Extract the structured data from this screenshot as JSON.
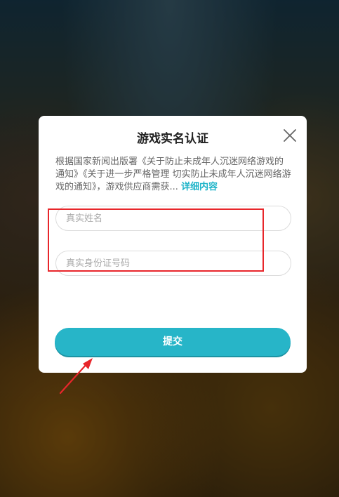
{
  "dialog": {
    "title": "游戏实名认证",
    "notice_text": "根据国家新闻出版署《关于防止未成年人沉迷网络游戏的通知》《关于进一步严格管理 切实防止未成年人沉迷网络游戏的通知》，游戏供应商需获...",
    "details_link": "详细内容",
    "name_placeholder": "真实姓名",
    "id_placeholder": "真实身份证号码",
    "submit_label": "提交"
  },
  "colors": {
    "accent": "#27b5c8",
    "link": "#1bb3c8",
    "annotation": "#e8262b"
  },
  "icons": {
    "close": "close-icon",
    "arrow": "red-arrow-annotation"
  }
}
